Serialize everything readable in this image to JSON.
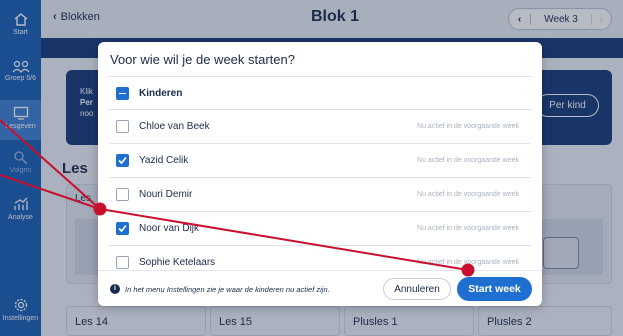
{
  "sidebar": {
    "items": [
      {
        "label": "Start",
        "icon": "home-icon"
      },
      {
        "label": "Groep 5/6",
        "icon": "group-icon"
      },
      {
        "label": "Lesgeven",
        "icon": "teach-icon"
      },
      {
        "label": "Volgen",
        "icon": "follow-icon"
      },
      {
        "label": "Analyse",
        "icon": "chart-icon"
      },
      {
        "label": "Instellingen",
        "icon": "gear-icon"
      }
    ]
  },
  "header": {
    "back_label": "Blokken",
    "title": "Blok 1",
    "week_label": "Week 3"
  },
  "background": {
    "info_lines": [
      "Klik",
      "Per",
      "noo"
    ],
    "per_kind_label": "Per kind",
    "section_heading": "Les",
    "cards": [
      "Les",
      "Les 14",
      "Les 15",
      "Plusles 1",
      "Plusles 2"
    ]
  },
  "modal": {
    "title": "Voor wie wil je de week starten?",
    "select_all_label": "Kinderen",
    "students": [
      {
        "name": "Chloe van Beek",
        "checked": false,
        "status": "Nu actief in de voorgaande week"
      },
      {
        "name": "Yazid Celik",
        "checked": true,
        "status": "Nu actief in de voorgaande week"
      },
      {
        "name": "Nouri Demir",
        "checked": false,
        "status": "Nu actief in de voorgaande week"
      },
      {
        "name": "Noor van Dijk",
        "checked": true,
        "status": "Nu actief in de voorgaande week"
      },
      {
        "name": "Sophie Ketelaars",
        "checked": false,
        "status": "Nu actief in de voorgaande week"
      }
    ],
    "footer_note": "In het menu Instellingen zie je waar de kinderen nu actief zijn.",
    "cancel_label": "Annuleren",
    "start_label": "Start week"
  },
  "colors": {
    "sidebar": "#1a5fb4",
    "navy": "#173a78",
    "accent": "#1f6fd1",
    "annotation": "#c8102e"
  }
}
